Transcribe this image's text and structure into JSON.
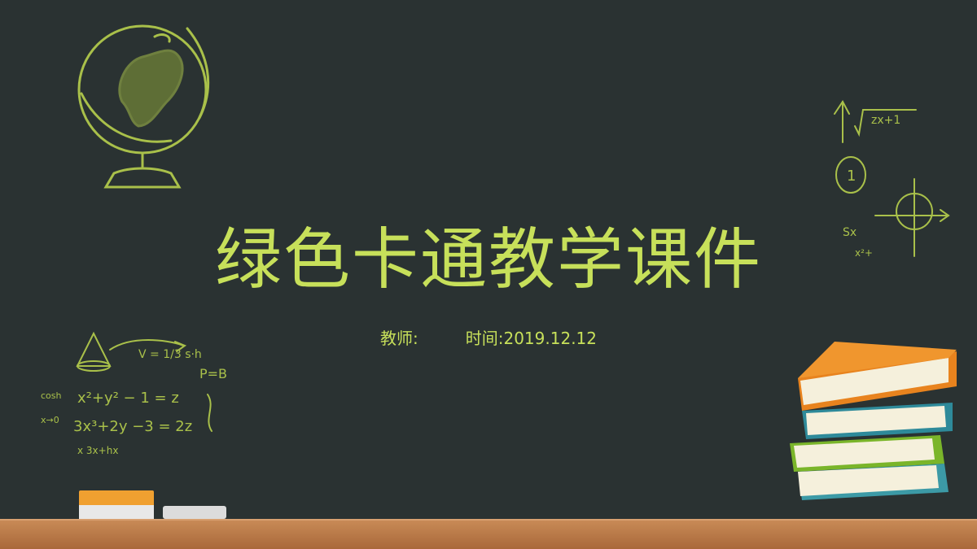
{
  "slide": {
    "title": "绿色卡通教学课件",
    "teacher_label": "教师:",
    "time_label": "时间:",
    "date": "2019.12.12"
  },
  "colors": {
    "chalkboard": "#283030",
    "chalk": "#c7e05a",
    "shelf": "#b8794a"
  },
  "icons": [
    "globe-icon",
    "math-doodle-icon",
    "formula-doodle-icon",
    "book-stack-icon",
    "eraser-icon",
    "chalk-icon"
  ]
}
